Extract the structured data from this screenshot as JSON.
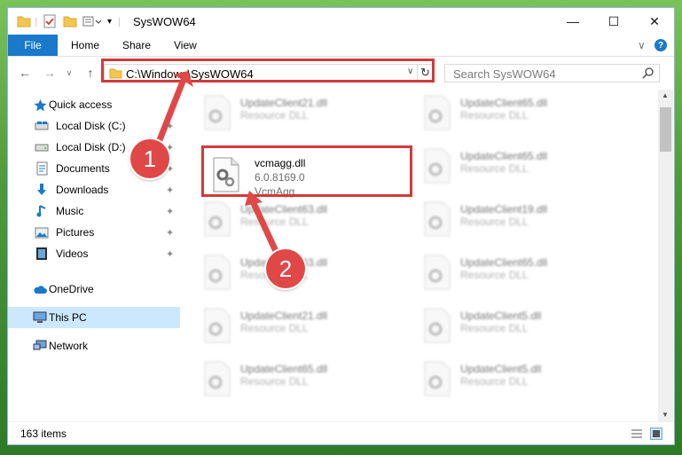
{
  "window": {
    "title": "SysWOW64",
    "minimize_glyph": "—",
    "maximize_glyph": "☐",
    "close_glyph": "✕"
  },
  "ribbon": {
    "tabs": [
      "File",
      "Home",
      "Share",
      "View"
    ],
    "expand_glyph": "∨",
    "help_glyph": "?"
  },
  "navigation": {
    "back_glyph": "←",
    "forward_glyph": "→",
    "dropdown_glyph": "∨",
    "up_glyph": "↑",
    "address": "C:\\Windows\\SysWOW64",
    "refresh_glyph": "↻",
    "search_placeholder": "Search SysWOW64"
  },
  "sidebar": {
    "items": [
      {
        "label": "Quick access",
        "icon": "star-icon"
      },
      {
        "label": "Local Disk (C:)",
        "icon": "drive-icon",
        "pinned": true
      },
      {
        "label": "Local Disk (D:)",
        "icon": "drive-icon",
        "pinned": true
      },
      {
        "label": "Documents",
        "icon": "documents-icon",
        "pinned": true
      },
      {
        "label": "Downloads",
        "icon": "download-icon",
        "pinned": true
      },
      {
        "label": "Music",
        "icon": "music-icon",
        "pinned": true
      },
      {
        "label": "Pictures",
        "icon": "pictures-icon",
        "pinned": true
      },
      {
        "label": "Videos",
        "icon": "videos-icon",
        "pinned": true
      },
      {
        "label": "OneDrive",
        "icon": "cloud-icon"
      },
      {
        "label": "This PC",
        "icon": "computer-icon",
        "selected": true
      },
      {
        "label": "Network",
        "icon": "network-icon"
      }
    ],
    "pin_glyph": "📌"
  },
  "files": {
    "highlighted": {
      "name": "vcmagg.dll",
      "version": "6.0.8169.0",
      "description": "VcmAgg"
    },
    "blurred_left": [
      {
        "name": "UpdateClient21.dll",
        "type": "Resource DLL"
      },
      {
        "name": "UpdateClient63.dll",
        "type": "Resource DLL"
      },
      {
        "name": "UpdateClient63.dll",
        "type": "Resource DLL"
      },
      {
        "name": "UpdateClient21.dll",
        "type": "Resource DLL"
      },
      {
        "name": "UpdateClient65.dll",
        "type": "Resource DLL"
      }
    ],
    "blurred_right": [
      {
        "name": "UpdateClient65.dll",
        "type": "Resource DLL"
      },
      {
        "name": "UpdateClient65.dll",
        "type": "Resource DLL"
      },
      {
        "name": "UpdateClient19.dll",
        "type": "Resource DLL"
      },
      {
        "name": "UpdateClient65.dll",
        "type": "Resource DLL"
      },
      {
        "name": "UpdateClient5.dll",
        "type": "Resource DLL"
      },
      {
        "name": "UpdateClient5.dll",
        "type": "Resource DLL"
      }
    ]
  },
  "status": {
    "items_count": "163 items"
  },
  "annotations": {
    "step1": "1",
    "step2": "2"
  },
  "colors": {
    "accent": "#1979ca",
    "highlight": "#d23a3a",
    "selection": "#cce8ff"
  }
}
